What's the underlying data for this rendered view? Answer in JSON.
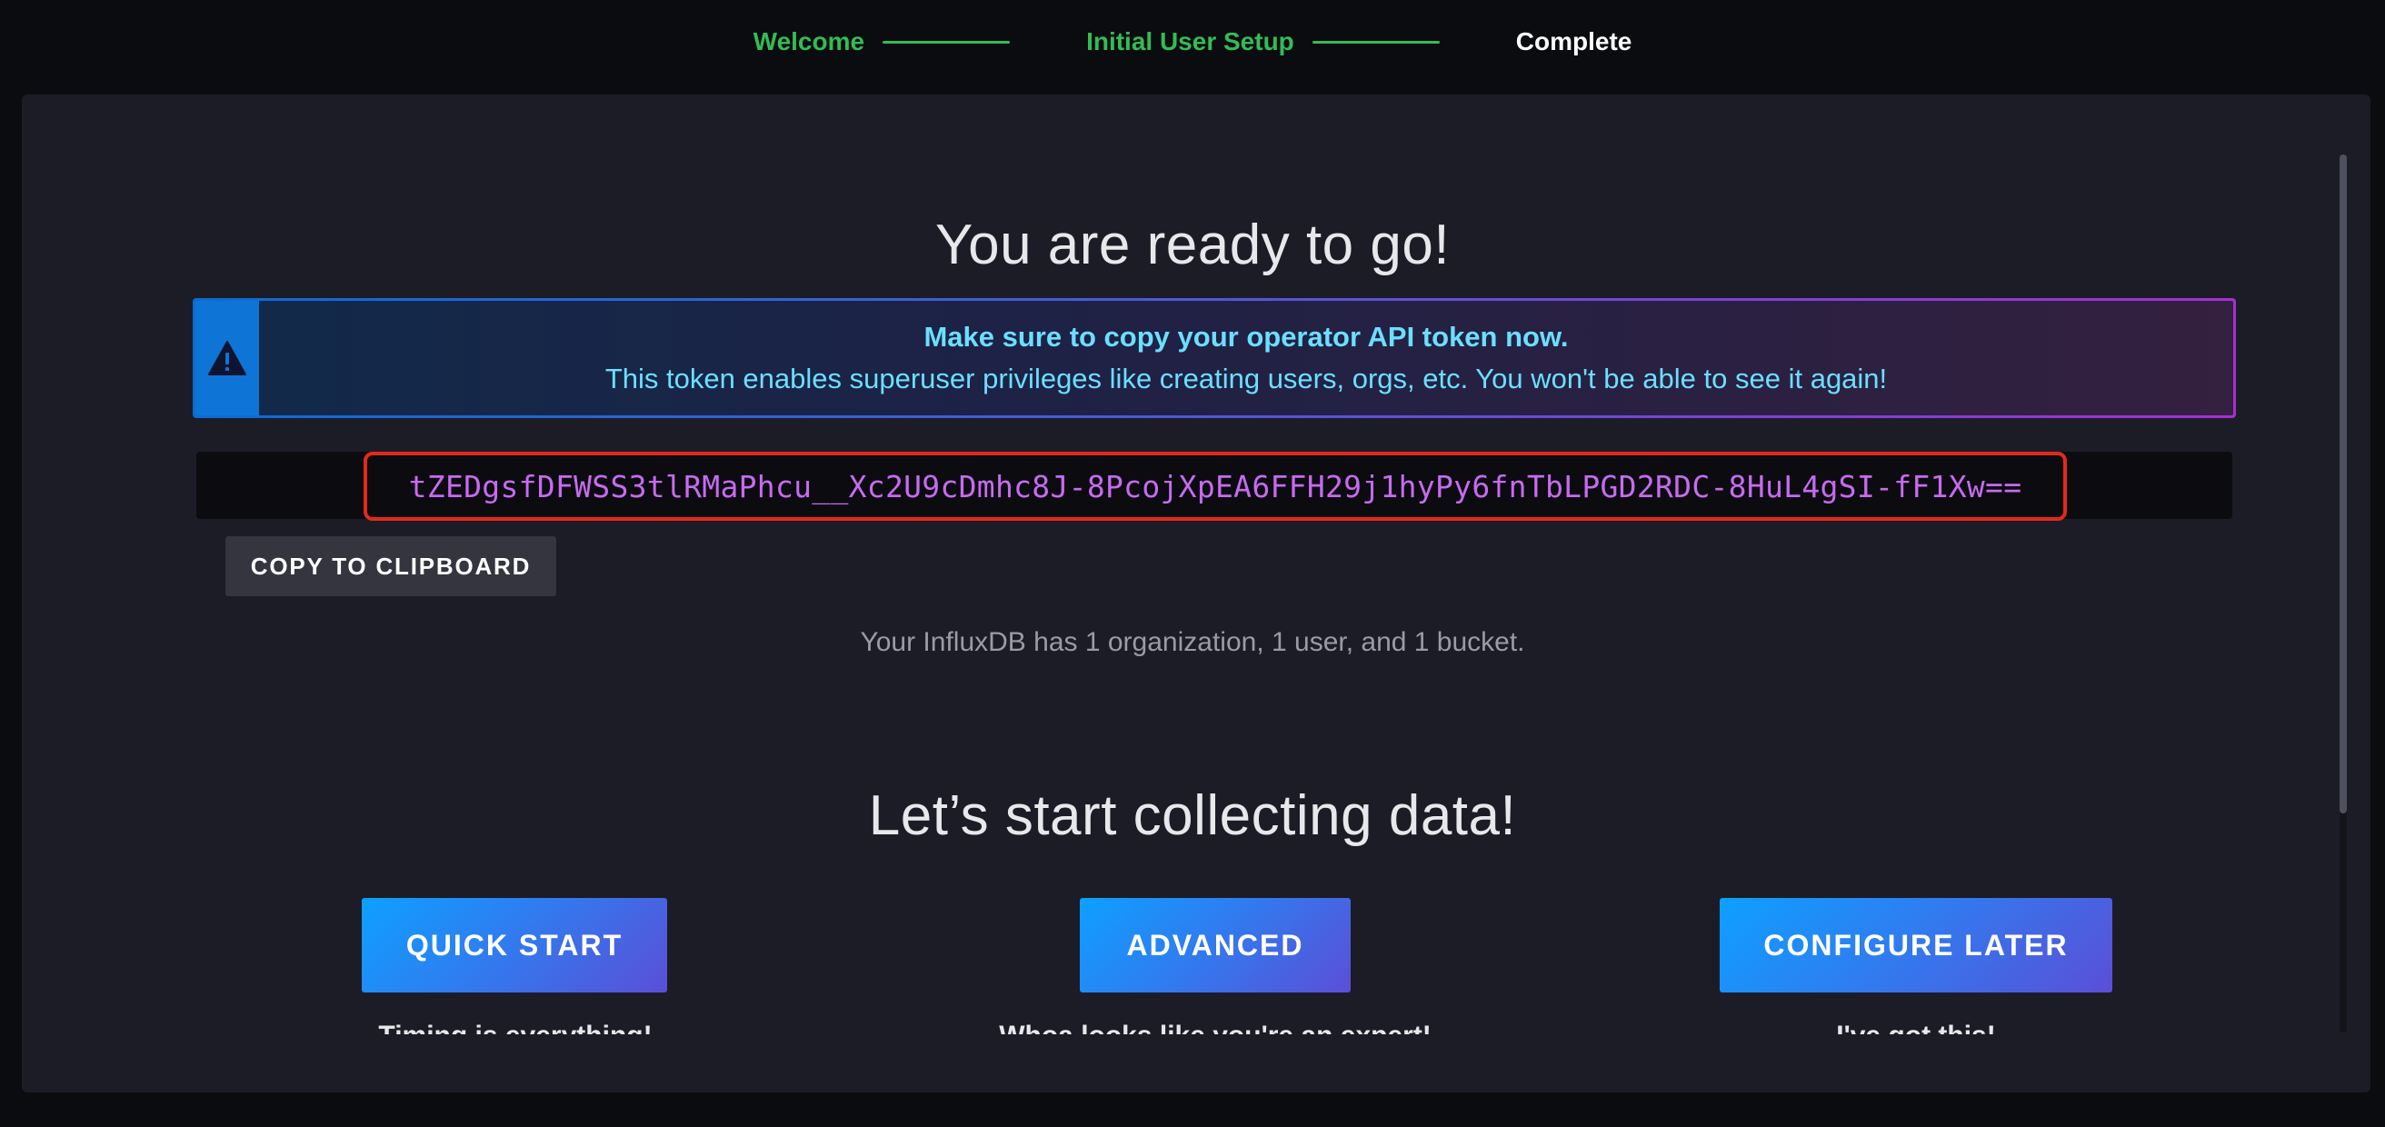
{
  "stepper": {
    "steps": [
      {
        "label": "Welcome",
        "state": "done"
      },
      {
        "label": "Initial User Setup",
        "state": "done"
      },
      {
        "label": "Complete",
        "state": "current"
      }
    ]
  },
  "main": {
    "heading": "You are ready to go!",
    "alert": {
      "icon": "alert-triangle-icon",
      "title": "Make sure to copy your operator API token now.",
      "body": "This token enables superuser privileges like creating users, orgs, etc. You won't be able to see it again!"
    },
    "token": {
      "value": "tZEDgsfDFWSS3tlRMaPhcu__Xc2U9cDmhc8J-8PcojXpEA6FFH29j1hyPy6fnTbLPGD2RDC-8HuL4gSI-fF1Xw=="
    },
    "copy_button": "COPY TO CLIPBOARD",
    "summary": "Your InfluxDB has 1 organization, 1 user, and 1 bucket.",
    "subheading": "Let’s start collecting data!",
    "actions": [
      {
        "label": "QUICK START",
        "caption": "Timing is everything!"
      },
      {
        "label": "ADVANCED",
        "caption": "Whoa looks like you're an expert!"
      },
      {
        "label": "CONFIGURE LATER",
        "caption": "I've got this!"
      }
    ]
  },
  "colors": {
    "success_green": "#34bb55",
    "token_magenta": "#c86af0",
    "alert_cyan": "#6bdfff",
    "highlight_red": "#e4291c",
    "button_gradient_start": "#0ea0ff",
    "button_gradient_end": "#5b4fd7",
    "panel_background": "#1c1c26"
  }
}
